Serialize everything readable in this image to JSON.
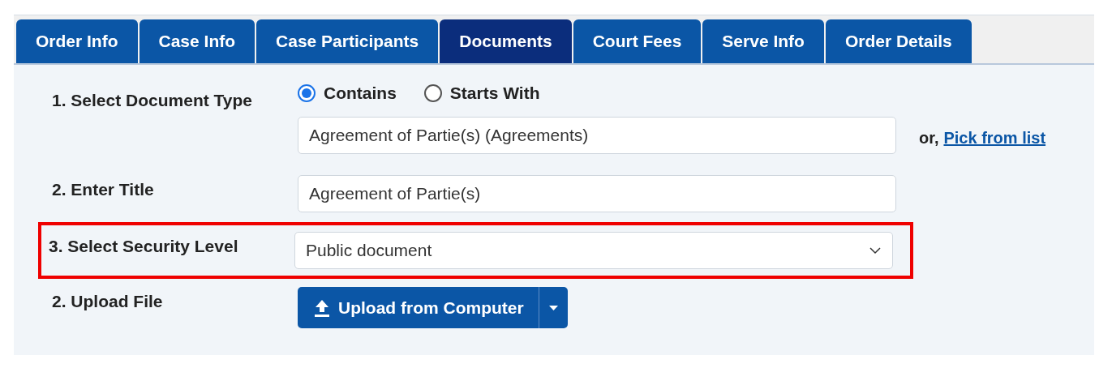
{
  "tabs": [
    {
      "label": "Order Info",
      "selected": false
    },
    {
      "label": "Case Info",
      "selected": false
    },
    {
      "label": "Case Participants",
      "selected": false
    },
    {
      "label": "Documents",
      "selected": true
    },
    {
      "label": "Court Fees",
      "selected": false
    },
    {
      "label": "Serve Info",
      "selected": false
    },
    {
      "label": "Order Details",
      "selected": false
    }
  ],
  "document_type": {
    "label": "1. Select Document Type",
    "options": [
      {
        "label": "Contains",
        "selected": true
      },
      {
        "label": "Starts With",
        "selected": false
      }
    ],
    "value": "Agreement of Partie(s) (Agreements)",
    "or_text": "or,",
    "link": "Pick from list"
  },
  "title": {
    "label": "2. Enter Title",
    "value": "Agreement of Partie(s)"
  },
  "security_level": {
    "label": "3. Select Security Level",
    "value": "Public document",
    "highlighted": true
  },
  "upload": {
    "label": "2. Upload File",
    "button": "Upload from Computer"
  }
}
